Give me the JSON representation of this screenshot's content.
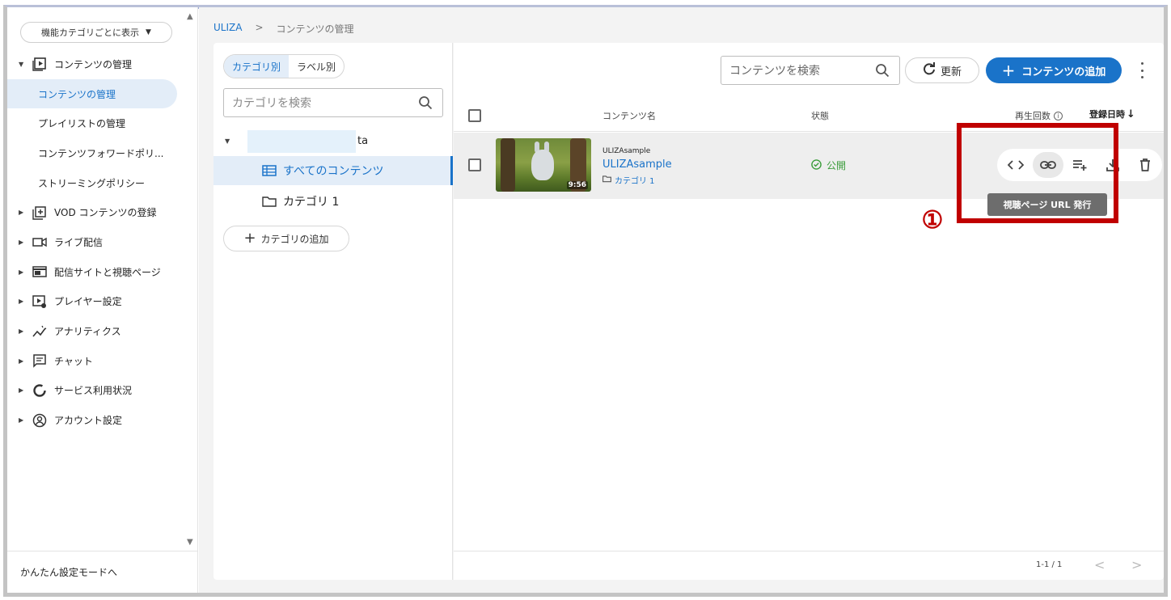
{
  "sidebar": {
    "mode_select": "機能カテゴリごとに表示",
    "items": [
      {
        "label": "コンテンツの管理",
        "icon": "play-box-icon",
        "expanded": true
      },
      {
        "label": "コンテンツの管理",
        "sub": true,
        "active": true
      },
      {
        "label": "プレイリストの管理",
        "sub": true
      },
      {
        "label": "コンテンツフォワードポリ...",
        "sub": true
      },
      {
        "label": "ストリーミングポリシー",
        "sub": true
      },
      {
        "label": "VOD コンテンツの登録",
        "icon": "library-add-icon"
      },
      {
        "label": "ライブ配信",
        "icon": "video-camera-icon"
      },
      {
        "label": "配信サイトと視聴ページ",
        "icon": "web-page-icon"
      },
      {
        "label": "プレイヤー設定",
        "icon": "player-settings-icon"
      },
      {
        "label": "アナリティクス",
        "icon": "analytics-icon"
      },
      {
        "label": "チャット",
        "icon": "chat-icon"
      },
      {
        "label": "サービス利用状況",
        "icon": "donut-icon"
      },
      {
        "label": "アカウント設定",
        "icon": "account-circle-icon"
      }
    ],
    "footer": "かんたん設定モードへ"
  },
  "breadcrumb": {
    "root": "ULIZA",
    "sep": ">",
    "current": "コンテンツの管理"
  },
  "category_panel": {
    "tab_category": "カテゴリ別",
    "tab_label": "ラベル別",
    "search_placeholder": "カテゴリを検索",
    "root_suffix": "ta",
    "all_contents": "すべてのコンテンツ",
    "category1": "カテゴリ 1",
    "add_category": "カテゴリの追加"
  },
  "content_panel": {
    "search_placeholder": "コンテンツを検索",
    "refresh": "更新",
    "add_content": "コンテンツの追加",
    "columns": {
      "name": "コンテンツ名",
      "status": "状態",
      "plays": "再生回数",
      "date": "登録日時"
    },
    "row": {
      "sub": "ULIZAsample",
      "title": "ULIZAsample",
      "category": "カテゴリ 1",
      "status": "公開",
      "duration": "9:56"
    },
    "tooltip": "視聴ページ URL 発行",
    "pager": {
      "range": "1-1 / 1",
      "prev": "<",
      "next": ">"
    }
  },
  "annotation": {
    "badge": "①",
    "color": "#c00000"
  },
  "colors": {
    "accent": "#1a73c9",
    "active_bg": "#e3edf8",
    "status_green": "#3a9c3a"
  }
}
